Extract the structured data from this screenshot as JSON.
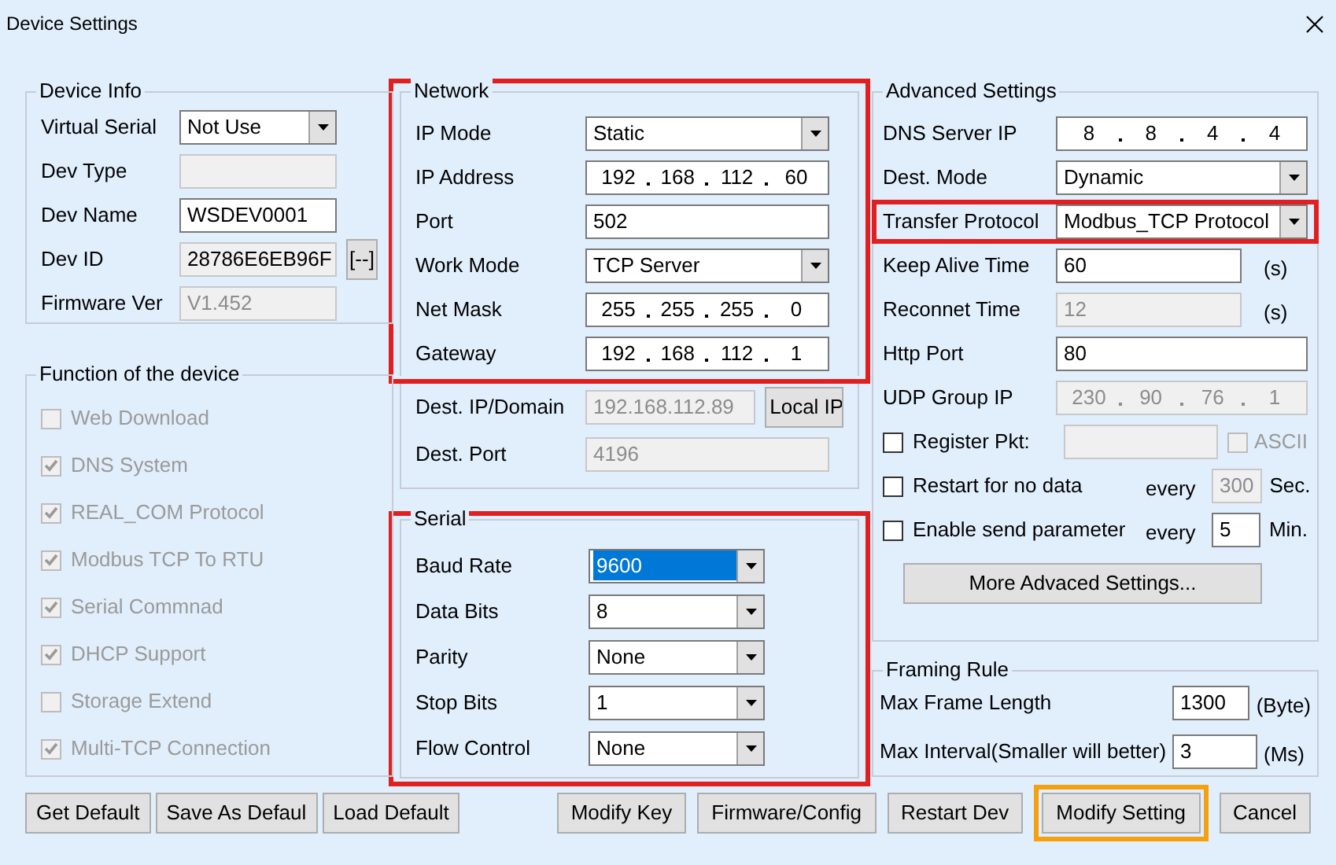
{
  "window": {
    "title": "Device Settings"
  },
  "device_info": {
    "title": "Device Info",
    "fields": [
      {
        "label": "Virtual Serial",
        "kind": "select",
        "value": "Not Use",
        "disabled": false
      },
      {
        "label": "Dev Type",
        "kind": "text",
        "disabled": true
      },
      {
        "label": "Dev Name",
        "kind": "text",
        "value": "WSDEV0001",
        "disabled": false
      },
      {
        "label": "Dev ID",
        "kind": "readonly",
        "value": "28786E6EB96F",
        "disabled": false,
        "button": "[--]"
      },
      {
        "label": "Firmware Ver",
        "kind": "text",
        "value": "V1.452",
        "disabled": true
      }
    ]
  },
  "function": {
    "title": "Function of the device",
    "items": [
      {
        "label": "Web Download",
        "checked": false,
        "disabled": true
      },
      {
        "label": "DNS System",
        "checked": true,
        "disabled": true
      },
      {
        "label": "REAL_COM Protocol",
        "checked": true,
        "disabled": true
      },
      {
        "label": "Modbus TCP To RTU",
        "checked": true,
        "disabled": true
      },
      {
        "label": "Serial Commnad",
        "checked": true,
        "disabled": true
      },
      {
        "label": "DHCP Support",
        "checked": true,
        "disabled": true
      },
      {
        "label": "Storage Extend",
        "checked": false,
        "disabled": true
      },
      {
        "label": "Multi-TCP Connection",
        "checked": true,
        "disabled": true
      }
    ]
  },
  "network": {
    "title": "Network",
    "highlighted": true,
    "fields": [
      {
        "label": "IP Mode",
        "kind": "select",
        "value": "Static",
        "disabled": false
      },
      {
        "label": "IP Address",
        "kind": "ip",
        "octets": [
          "192",
          "168",
          "112",
          "60"
        ],
        "disabled": false
      },
      {
        "label": "Port",
        "kind": "text",
        "value": "502",
        "disabled": false
      },
      {
        "label": "Work Mode",
        "kind": "select",
        "value": "TCP Server",
        "disabled": false
      },
      {
        "label": "Net Mask",
        "kind": "ip",
        "octets": [
          "255",
          "255",
          "255",
          "0"
        ],
        "disabled": false
      },
      {
        "label": "Gateway",
        "kind": "ip",
        "octets": [
          "192",
          "168",
          "112",
          "1"
        ],
        "disabled": false
      }
    ],
    "dest_fields": [
      {
        "label": "Dest. IP/Domain",
        "kind": "text",
        "value": "192.168.112.89",
        "disabled": true,
        "button": "Local IP"
      },
      {
        "label": "Dest. Port",
        "kind": "text",
        "value": "4196",
        "disabled": true
      }
    ]
  },
  "serial": {
    "title": "Serial",
    "highlighted": true,
    "fields": [
      {
        "label": "Baud Rate",
        "value": "9600",
        "focused": true
      },
      {
        "label": "Data Bits",
        "value": "8",
        "focused": false
      },
      {
        "label": "Parity",
        "value": "None",
        "focused": false
      },
      {
        "label": "Stop Bits",
        "value": "1",
        "focused": false
      },
      {
        "label": "Flow Control",
        "value": "None",
        "focused": false
      }
    ]
  },
  "advanced": {
    "title": "Advanced Settings",
    "rows": [
      {
        "kind": "ip",
        "label": "DNS Server IP",
        "octets": [
          "8",
          "8",
          "4",
          "4"
        ],
        "disabled": false,
        "highlighted": false
      },
      {
        "kind": "select",
        "label": "Dest. Mode",
        "value": "Dynamic",
        "disabled": false,
        "highlighted": false
      },
      {
        "kind": "select",
        "label": "Transfer Protocol",
        "value": "Modbus_TCP Protocol",
        "disabled": false,
        "highlighted": true
      },
      {
        "kind": "text",
        "label": "Keep Alive Time",
        "value": "60",
        "unit": "(s)",
        "disabled": false,
        "highlighted": false
      },
      {
        "kind": "text",
        "label": "Reconnet Time",
        "value": "12",
        "unit": "(s)",
        "disabled": true,
        "highlighted": false
      },
      {
        "kind": "text",
        "label": "Http Port",
        "value": "80",
        "disabled": false,
        "highlighted": false
      },
      {
        "kind": "ip",
        "label": "UDP Group IP",
        "octets": [
          "230",
          "90",
          "76",
          "1"
        ],
        "disabled": true,
        "highlighted": false
      },
      {
        "kind": "check_field",
        "label": "Register Pkt:",
        "checked": false,
        "disabled": true,
        "highlighted": false,
        "option": {
          "label": "ASCII",
          "checked": false,
          "disabled": true
        }
      },
      {
        "kind": "check_every",
        "label": "Restart for no data",
        "checked": false,
        "every": "every",
        "value": "300",
        "unit": "Sec.",
        "disabled": true,
        "highlighted": false
      },
      {
        "kind": "check_every",
        "label": "Enable send parameter",
        "checked": false,
        "every": "every",
        "value": "5",
        "unit": "Min.",
        "disabled": false,
        "highlighted": false
      },
      {
        "kind": "button",
        "label": "More Advaced Settings...",
        "disabled": false,
        "highlighted": false
      }
    ]
  },
  "framing": {
    "title": "Framing Rule",
    "rows": [
      {
        "label": "Max Frame Length",
        "value": "1300",
        "unit": "(Byte)"
      },
      {
        "label": "Max Interval(Smaller will better)",
        "value": "3",
        "unit": "(Ms)"
      }
    ]
  },
  "buttons_left": [
    {
      "label": "Get Default",
      "highlighted": false
    },
    {
      "label": "Save As Defaul",
      "highlighted": false
    },
    {
      "label": "Load Default",
      "highlighted": false
    }
  ],
  "buttons_right": [
    {
      "label": "Modify Key",
      "highlighted": false
    },
    {
      "label": "Firmware/Config",
      "highlighted": false
    },
    {
      "label": "Restart Dev",
      "highlighted": false
    },
    {
      "label": "Modify Setting",
      "highlighted": true
    },
    {
      "label": "Cancel",
      "highlighted": false
    }
  ]
}
